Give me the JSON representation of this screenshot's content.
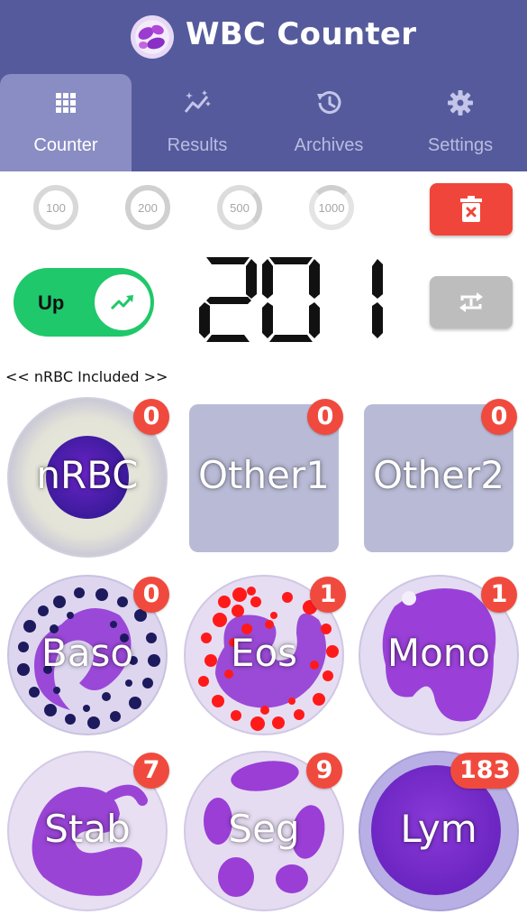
{
  "header": {
    "title": "WBC Counter",
    "logo_icon": "blood-cell-logo-icon"
  },
  "tabs": [
    {
      "label": "Counter",
      "icon": "grid-icon",
      "active": true
    },
    {
      "label": "Results",
      "icon": "sparkle-chart-icon",
      "active": false
    },
    {
      "label": "Archives",
      "icon": "history-icon",
      "active": false
    },
    {
      "label": "Settings",
      "icon": "gear-icon",
      "active": false
    }
  ],
  "goals": [
    "100",
    "200",
    "500",
    "1000"
  ],
  "toggle": {
    "label": "Up",
    "icon": "trending-up-icon"
  },
  "counter": {
    "value": "201"
  },
  "note": "<< nRBC Included >>",
  "colors": {
    "header": "#555a9c",
    "active_tab": "#8a8dc3",
    "badge": "#f04a3e",
    "toggle": "#1fc86a",
    "trash": "#f0453a"
  },
  "cells": [
    {
      "label": "nRBC",
      "count": "0"
    },
    {
      "label": "Other1",
      "count": "0"
    },
    {
      "label": "Other2",
      "count": "0"
    },
    {
      "label": "Baso",
      "count": "0"
    },
    {
      "label": "Eos",
      "count": "1"
    },
    {
      "label": "Mono",
      "count": "1"
    },
    {
      "label": "Stab",
      "count": "7"
    },
    {
      "label": "Seg",
      "count": "9"
    },
    {
      "label": "Lym",
      "count": "183"
    }
  ]
}
